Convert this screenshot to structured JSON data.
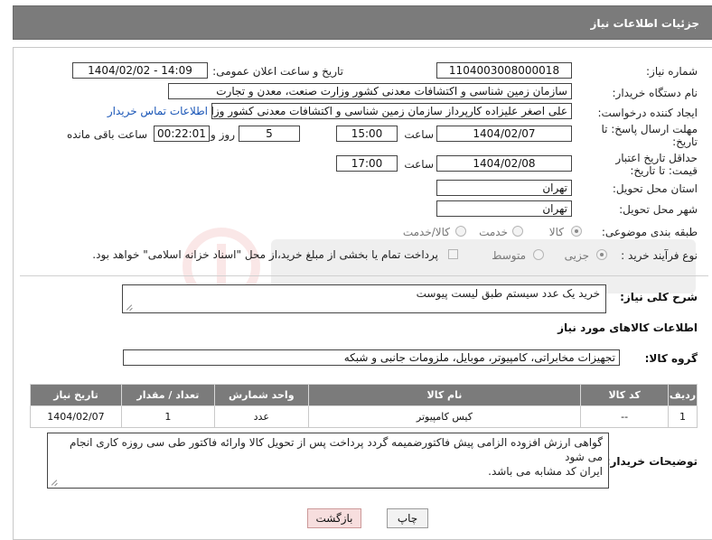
{
  "header": {
    "title": "جزئیات اطلاعات نیاز"
  },
  "form": {
    "need_number_label": "شماره نیاز:",
    "need_number": "1104003008000018",
    "announce_label": "تاریخ و ساعت اعلان عمومی:",
    "announce_value": "1404/02/02 - 14:09",
    "buyer_org_label": "نام دستگاه خریدار:",
    "buyer_org": "سازمان زمین شناسی و اکتشافات معدنی کشور وزارت صنعت، معدن و تجارت",
    "creator_label": "ایجاد کننده درخواست:",
    "creator": "علی اصغر علیزاده کارپرداز سازمان زمین شناسی و اکتشافات معدنی کشور وزارت",
    "contact_link": "اطلاعات تماس خریدار",
    "reply_deadline_label": "مهلت ارسال پاسخ: تا تاریخ:",
    "reply_date": "1404/02/07",
    "time_label": "ساعت",
    "reply_time": "15:00",
    "days_value": "5",
    "days_label": "روز و",
    "remaining_value": "00:22:01",
    "remaining_label": "ساعت باقی مانده",
    "price_validity_label": "حداقل تاریخ اعتبار قیمت: تا تاریخ:",
    "price_date": "1404/02/08",
    "price_time": "17:00",
    "province_label": "استان محل تحویل:",
    "province": "تهران",
    "city_label": "شهر محل تحویل:",
    "city": "تهران",
    "category_label": "طبقه بندی موضوعی:",
    "category_options": [
      "کالا",
      "خدمت",
      "کالا/خدمت"
    ],
    "process_label": "نوع فرآیند خرید :",
    "process_options": [
      "جزیی",
      "متوسط"
    ],
    "payment_note": "پرداخت تمام یا بخشی از مبلغ خرید،از محل \"اسناد خزانه اسلامی\" خواهد بود."
  },
  "description": {
    "label": "شرح کلی نیاز:",
    "value": "خرید یک عدد سیستم طبق لیست پیوست"
  },
  "goods": {
    "section_title": "اطلاعات کالاهای مورد نیاز",
    "group_label": "گروه کالا:",
    "group_value": "تجهیزات مخابراتی، کامپیوتر، موبایل، ملزومات جانبی و شبکه",
    "columns": [
      "ردیف",
      "کد کالا",
      "نام کالا",
      "واحد شمارش",
      "تعداد / مقدار",
      "تاریخ نیاز"
    ],
    "rows": [
      {
        "row": "1",
        "code": "--",
        "name": "کیس کامپیوتر",
        "unit": "عدد",
        "qty": "1",
        "date": "1404/02/07"
      }
    ]
  },
  "buyer_notes": {
    "label": "توضیحات خریدار:",
    "line1": "گواهی ارزش افزوده الزامی پیش فاکتورضمیمه گردد پرداخت پس از تحویل کالا وارائه فاکتور طی سی روزه کاری انجام می شود",
    "line2": "ایران کد مشابه می باشد."
  },
  "buttons": {
    "print": "چاپ",
    "back": "بازگشت"
  },
  "colors": {
    "header_bg": "#7b7b7b",
    "link": "#1a56b7",
    "back_button": "#f7dede"
  }
}
